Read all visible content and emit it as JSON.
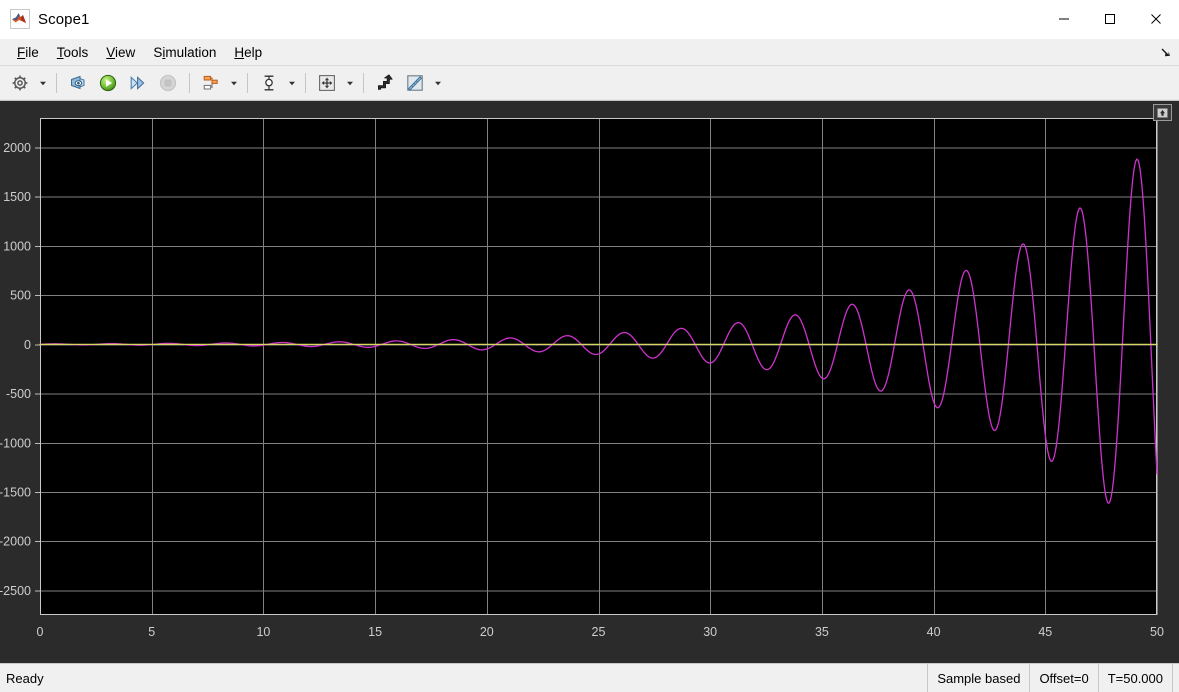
{
  "window": {
    "title": "Scope1",
    "icon": "matlab-icon",
    "controls": {
      "minimize": "minimize-icon",
      "maximize": "maximize-icon",
      "close": "close-icon"
    }
  },
  "menubar": {
    "items": [
      {
        "label": "File",
        "mnemonic": "F"
      },
      {
        "label": "Tools",
        "mnemonic": "T"
      },
      {
        "label": "View",
        "mnemonic": "V"
      },
      {
        "label": "Simulation",
        "mnemonic": "S"
      },
      {
        "label": "Help",
        "mnemonic": "H"
      }
    ],
    "undock_icon": "undock-arrow-icon"
  },
  "toolbar": {
    "items": [
      {
        "name": "configuration-properties-button",
        "icon": "gear-icon",
        "dropdown": true,
        "enabled": true
      },
      {
        "name": "print-button",
        "icon": "print-preview-icon",
        "dropdown": false,
        "enabled": true
      },
      {
        "name": "run-button",
        "icon": "play-icon",
        "dropdown": false,
        "enabled": true
      },
      {
        "name": "step-forward-button",
        "icon": "step-forward-icon",
        "dropdown": false,
        "enabled": true
      },
      {
        "name": "stop-button",
        "icon": "stop-icon",
        "dropdown": false,
        "enabled": false
      },
      {
        "name": "layout-button",
        "icon": "signal-layout-icon",
        "dropdown": true,
        "enabled": true
      },
      {
        "name": "cursor-measurements-button",
        "icon": "cursor-measurement-icon",
        "dropdown": true,
        "enabled": true
      },
      {
        "name": "scale-axes-limits-button",
        "icon": "fit-to-view-icon",
        "dropdown": true,
        "enabled": true
      },
      {
        "name": "highlight-signal-button",
        "icon": "highlight-signal-icon",
        "dropdown": false,
        "enabled": true
      },
      {
        "name": "style-button",
        "icon": "style-ruler-icon",
        "dropdown": true,
        "enabled": true
      }
    ]
  },
  "scope": {
    "axes_maximize_icon": "maximize-axes-icon",
    "background": "#000000",
    "panel_background": "#2b2b2b",
    "grid_color": "#808080",
    "tick_label_color": "#cdcdcd"
  },
  "statusbar": {
    "message": "Ready",
    "cells": [
      {
        "name": "sample-mode",
        "text": "Sample based"
      },
      {
        "name": "offset",
        "text": "Offset=0"
      },
      {
        "name": "simulation-time",
        "text": "T=50.000"
      }
    ]
  },
  "chart_data": {
    "type": "line",
    "title": "",
    "xlabel": "",
    "ylabel": "",
    "xlim": [
      0,
      50
    ],
    "ylim": [
      -2750,
      2300
    ],
    "xticks": [
      0,
      5,
      10,
      15,
      20,
      25,
      30,
      35,
      40,
      45,
      50
    ],
    "xtick_labels": [
      "0",
      "5",
      "10",
      "15",
      "20",
      "25",
      "30",
      "35",
      "40",
      "45",
      "50"
    ],
    "yticks": [
      2000,
      1500,
      1000,
      500,
      0,
      -500,
      -1000,
      -1500,
      -2000,
      -2500
    ],
    "ytick_labels": [
      "2000",
      "1500",
      "1000",
      "500",
      "0",
      "-500",
      "-1000",
      "-1500",
      "-2000",
      "-2500"
    ],
    "grid": true,
    "legend": null,
    "series": [
      {
        "name": "signal-1",
        "color": "#cc33cc",
        "description": "exponentially growing sinusoid (unstable oscillation)",
        "model": {
          "kind": "growing-sine",
          "amplitude0": 5.2,
          "growth_rate": 0.12,
          "period": 2.55,
          "phase": 0.0
        },
        "samples_per_unit": 20
      },
      {
        "name": "signal-2",
        "color": "#d8d860",
        "description": "constant zero reference line",
        "model": {
          "kind": "constant",
          "value": 0
        }
      }
    ]
  }
}
